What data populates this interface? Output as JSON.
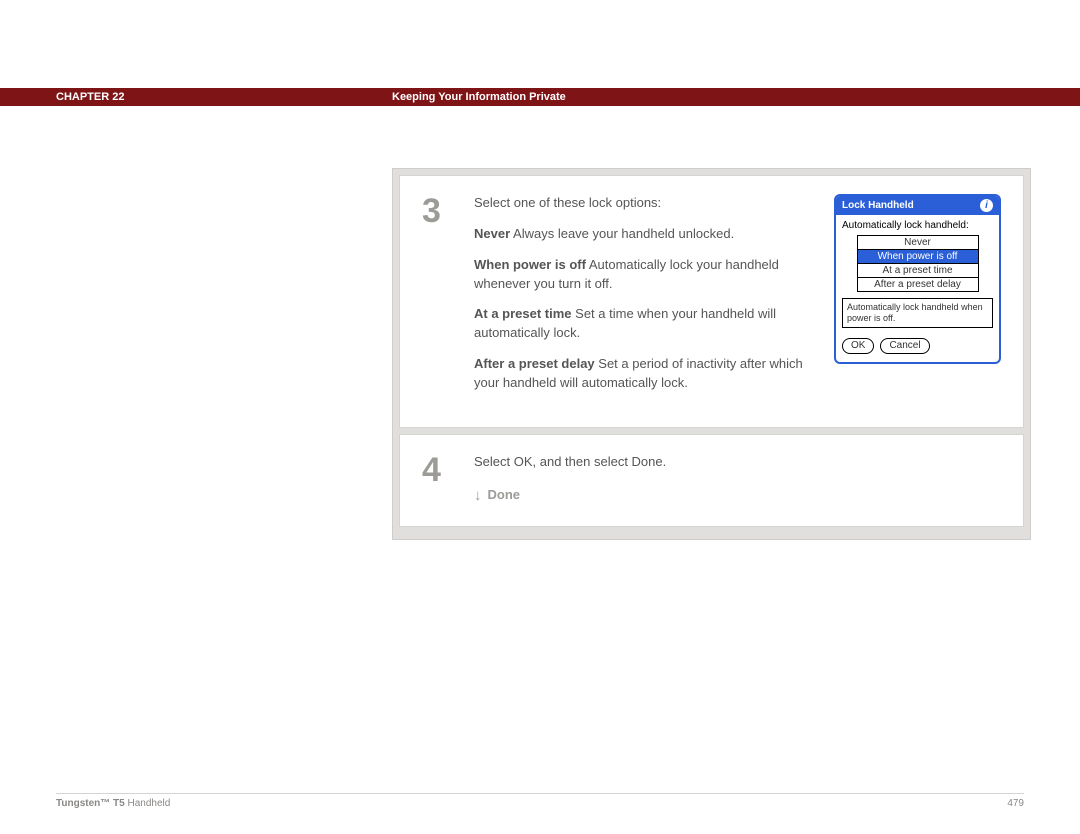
{
  "header": {
    "chapter_number": "22",
    "chapter_word": "CHAPTER",
    "title": "Keeping Your Information Private"
  },
  "steps": {
    "s3": {
      "num": "3",
      "intro": "Select one of these lock options:",
      "opts": [
        {
          "label": "Never",
          "desc": "   Always leave your handheld unlocked."
        },
        {
          "label": "When power is off",
          "desc": "   Automatically lock your handheld whenever you turn it off."
        },
        {
          "label": "At a preset time",
          "desc": "   Set a time when your handheld will automatically lock."
        },
        {
          "label": "After a preset delay",
          "desc": "   Set a period of inactivity after which your handheld will automatically lock."
        }
      ]
    },
    "s4": {
      "num": "4",
      "text": "Select OK, and then select Done.",
      "done": "Done"
    }
  },
  "dialog": {
    "title": "Lock Handheld",
    "label": "Automatically lock handheld:",
    "options": [
      "Never",
      "When power is off",
      "At a preset time",
      "After a preset delay"
    ],
    "selected_index": 1,
    "hint": "Automatically lock handheld when power is off.",
    "ok": "OK",
    "cancel": "Cancel"
  },
  "footer": {
    "product_bold": "Tungsten™ T5",
    "product_rest": " Handheld",
    "page": "479"
  }
}
